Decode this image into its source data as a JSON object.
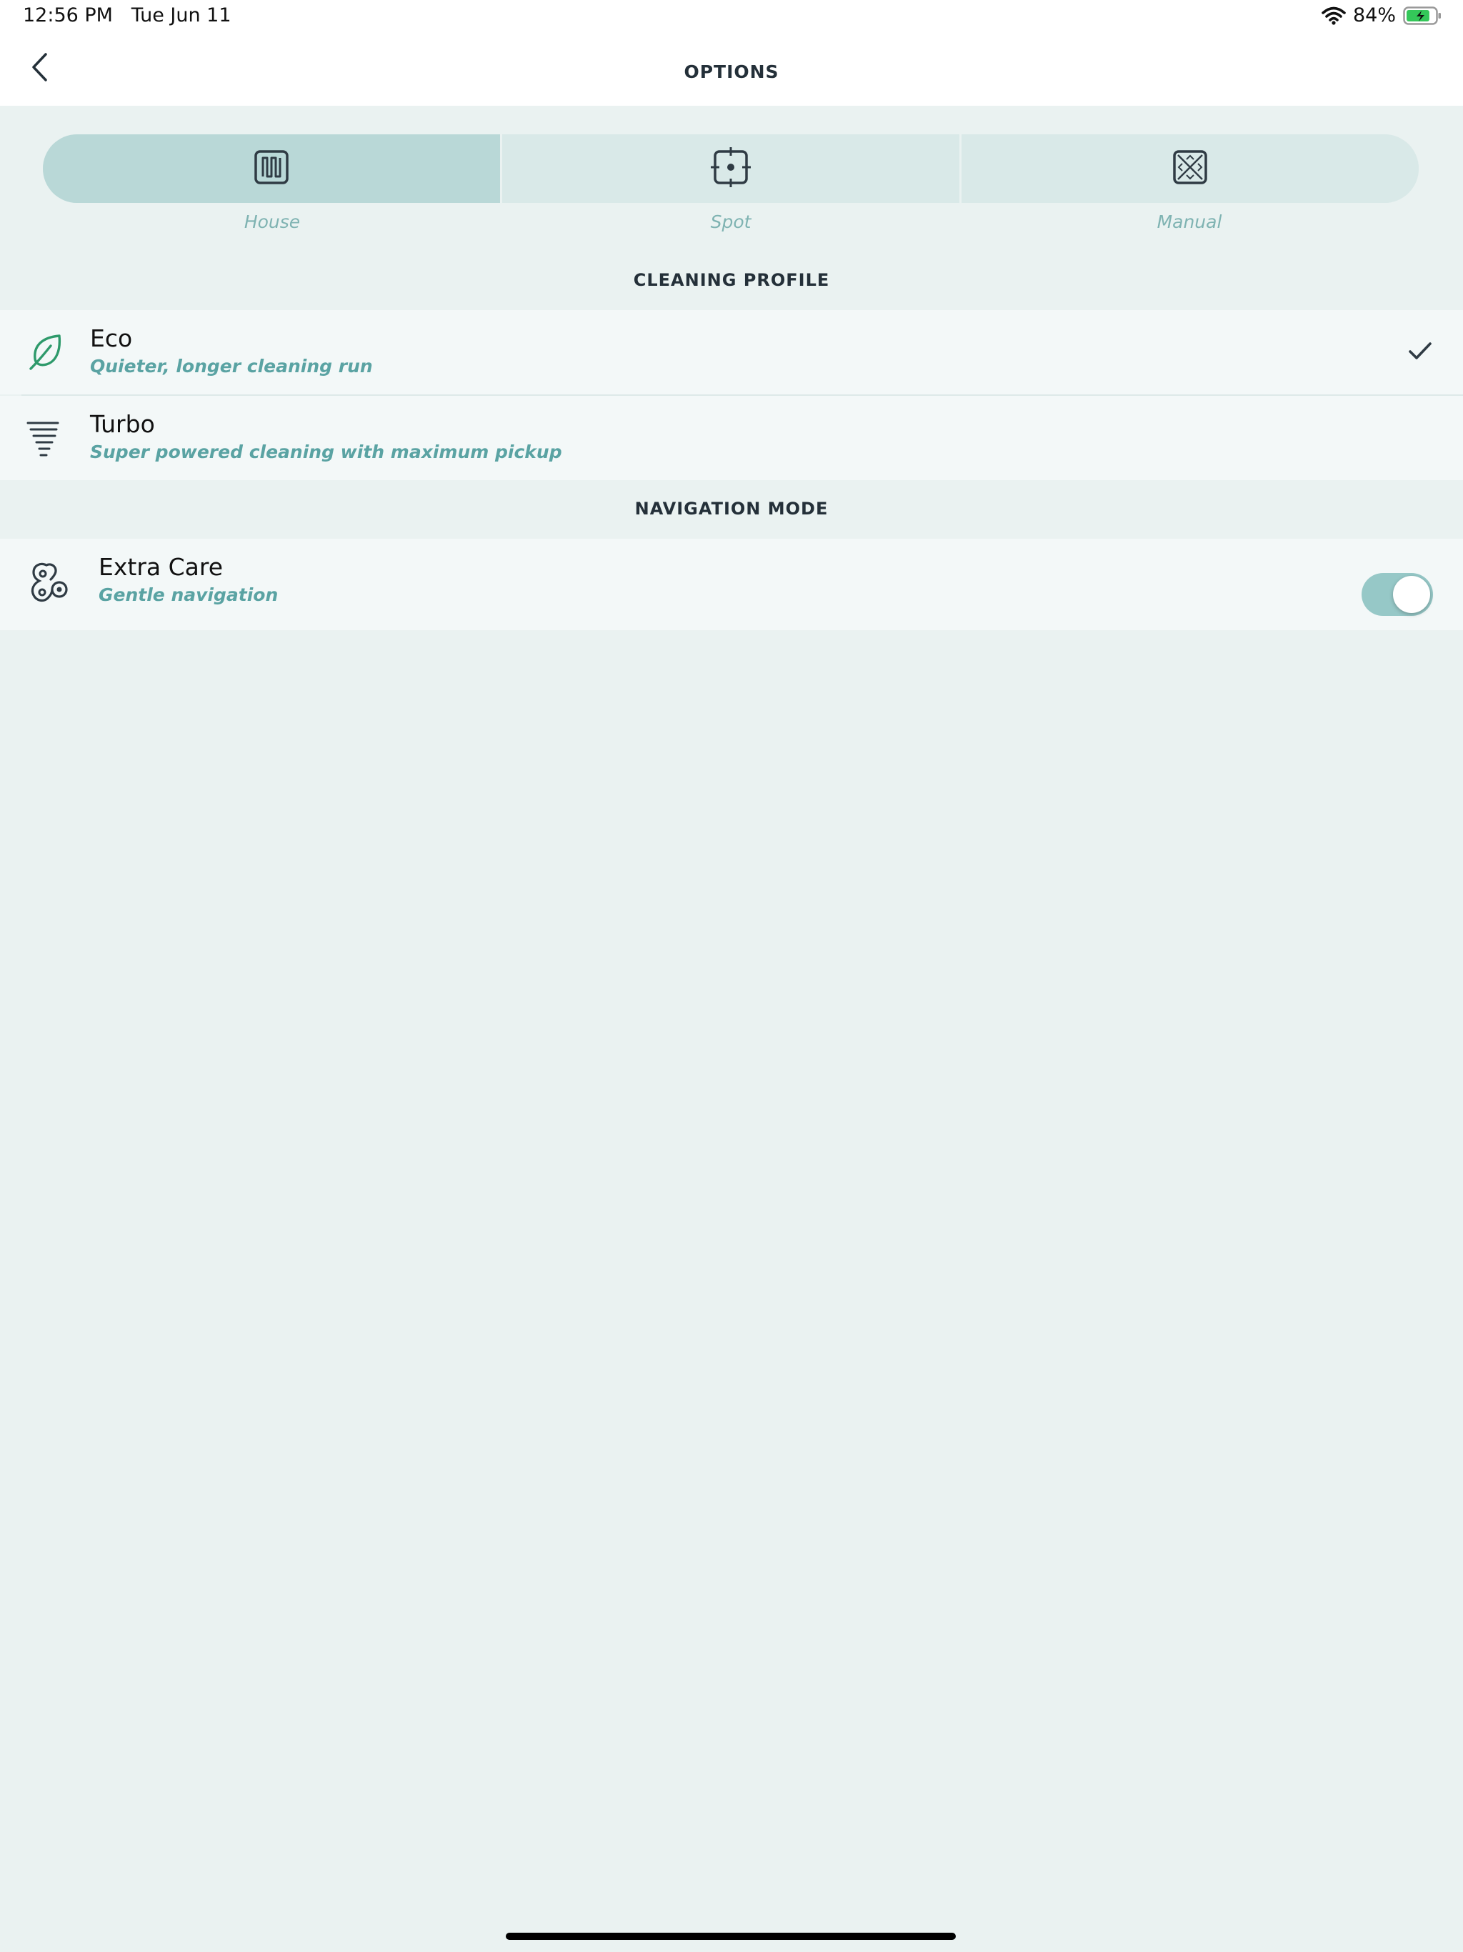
{
  "status_bar": {
    "time": "12:56 PM   Tue Jun 11",
    "battery_percent": "84%",
    "battery_level": 0.84,
    "battery_color": "#34c759"
  },
  "header": {
    "title": "OPTIONS",
    "back_icon": "chevron-left-icon"
  },
  "modes": {
    "selected": "House",
    "items": [
      {
        "label": "House",
        "icon": "house-mode-icon"
      },
      {
        "label": "Spot",
        "icon": "spot-mode-icon"
      },
      {
        "label": "Manual",
        "icon": "manual-mode-icon"
      }
    ]
  },
  "cleaning_profile": {
    "heading": "CLEANING PROFILE",
    "items": [
      {
        "title": "Eco",
        "subtitle": "Quieter, longer cleaning run",
        "icon": "leaf-icon",
        "selected": true
      },
      {
        "title": "Turbo",
        "subtitle": "Super powered cleaning with maximum pickup",
        "icon": "turbo-icon",
        "selected": false
      }
    ]
  },
  "navigation_mode": {
    "heading": "NAVIGATION MODE",
    "items": [
      {
        "title": "Extra Care",
        "subtitle": "Gentle navigation",
        "icon": "gentle-navigation-icon",
        "enabled": true
      }
    ]
  },
  "colors": {
    "accent": "#5aa3a3",
    "eco_green": "#2e9a6b",
    "background": "#eaf2f1"
  }
}
